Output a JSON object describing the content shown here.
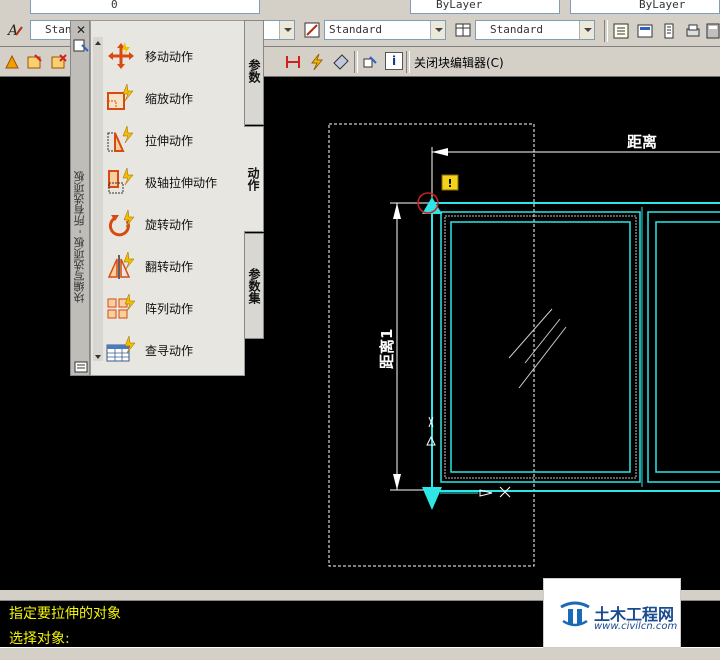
{
  "toolbar_top": {
    "layer_value": "0",
    "color_value": "ByLayer",
    "linetype_value": "ByLayer"
  },
  "toolbar_styles": {
    "text_style": "Stan",
    "dim_style": "Standard",
    "table_style": "Standard"
  },
  "block_editor": {
    "close_label": "关闭块编辑器(C)",
    "info_icon": "i"
  },
  "palette": {
    "vertical_title": "块编写选项板 - 所有选项板",
    "close_icon": "✕",
    "items": [
      {
        "label": "移动动作",
        "icon": "move-action-icon"
      },
      {
        "label": "缩放动作",
        "icon": "scale-action-icon"
      },
      {
        "label": "拉伸动作",
        "icon": "stretch-action-icon"
      },
      {
        "label": "极轴拉伸动作",
        "icon": "polar-stretch-action-icon"
      },
      {
        "label": "旋转动作",
        "icon": "rotate-action-icon"
      },
      {
        "label": "翻转动作",
        "icon": "flip-action-icon"
      },
      {
        "label": "阵列动作",
        "icon": "array-action-icon"
      },
      {
        "label": "查寻动作",
        "icon": "lookup-action-icon"
      }
    ],
    "tabs": [
      {
        "label": "参数"
      },
      {
        "label": "动作"
      },
      {
        "label": "参数集"
      }
    ]
  },
  "drawing": {
    "distance_label": "距离",
    "distance1_label": "距离1",
    "warning_icon": "!",
    "colors": {
      "cyan": "#2ee6e6",
      "white": "#ffffff",
      "warning": "#f2d21a"
    }
  },
  "command": {
    "line1": "指定要拉伸的对象",
    "line2": "选择对象:"
  },
  "watermark": {
    "title": "土木工程网",
    "url": "www.civilcn.com"
  }
}
